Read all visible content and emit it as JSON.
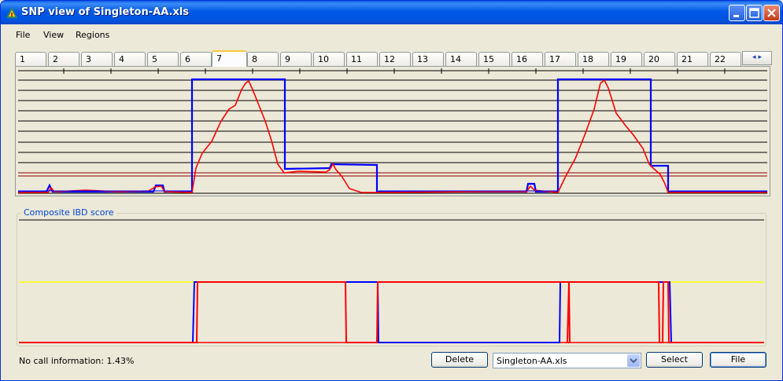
{
  "window": {
    "title": "SNP view of Singleton-AA.xls"
  },
  "menu": [
    "File",
    "View",
    "Regions"
  ],
  "chromosome_tabs": [
    "1",
    "2",
    "3",
    "4",
    "5",
    "6",
    "7",
    "8",
    "9",
    "10",
    "11",
    "12",
    "13",
    "14",
    "15",
    "16",
    "17",
    "18",
    "19",
    "20",
    "21",
    "22"
  ],
  "active_tab": "7",
  "composite": {
    "label": "Composite IBD score"
  },
  "status": {
    "no_call": "No call information: 1.43%"
  },
  "buttons": {
    "delete": "Delete",
    "select": "Select",
    "file": "File"
  },
  "file_select": {
    "value": "Singleton-AA.xls"
  },
  "colors": {
    "blue_series": "#0000FF",
    "red_series": "#FF0000",
    "threshold": "#FFFF00",
    "accent": "#0054E3"
  },
  "chart_data": [
    {
      "type": "line",
      "description_source": "upper SNP view (chromosome 7)",
      "series": [
        {
          "color": "blue",
          "x": [
            0,
            0.23,
            0.23,
            0.36,
            0.36,
            0.42,
            0.42,
            0.48,
            0.48,
            0.72,
            0.72,
            0.85,
            0.85,
            0.87,
            0.87,
            1.0
          ],
          "y": [
            0.02,
            0.02,
            1.0,
            1.0,
            0.22,
            0.22,
            0.27,
            0.27,
            0.03,
            0.03,
            1.0,
            1.0,
            0.27,
            0.27,
            0.02,
            0.02
          ]
        },
        {
          "color": "red",
          "x": [
            0,
            0.23,
            0.25,
            0.28,
            0.31,
            0.34,
            0.36,
            0.42,
            0.45,
            0.48,
            0.72,
            0.75,
            0.78,
            0.81,
            0.84,
            0.86,
            1.0
          ],
          "y": [
            0.02,
            0.02,
            0.3,
            0.7,
            0.95,
            0.6,
            0.2,
            0.2,
            0.05,
            0.02,
            0.02,
            0.5,
            0.95,
            0.6,
            0.4,
            0.02,
            0.02
          ]
        }
      ]
    },
    {
      "type": "line",
      "description_source": "composite IBD score panel",
      "series": [
        {
          "color": "blue",
          "x": [
            0,
            0.235,
            0.235,
            0.47,
            0.47,
            0.725,
            0.725,
            0.87,
            0.87,
            1.0
          ],
          "y": [
            0,
            0,
            1,
            1,
            0,
            0,
            1,
            1,
            0,
            0
          ]
        },
        {
          "color": "red",
          "x": [
            0,
            0.24,
            0.24,
            0.44,
            0.44,
            0.48,
            0.48,
            0.735,
            0.735,
            0.86,
            0.86,
            1.0
          ],
          "y": [
            0,
            0,
            1,
            1,
            0,
            0,
            1,
            1,
            0,
            0,
            1,
            0
          ]
        },
        {
          "color": "yellow",
          "x": [
            0,
            1.0
          ],
          "y": [
            1,
            1
          ]
        }
      ]
    }
  ]
}
